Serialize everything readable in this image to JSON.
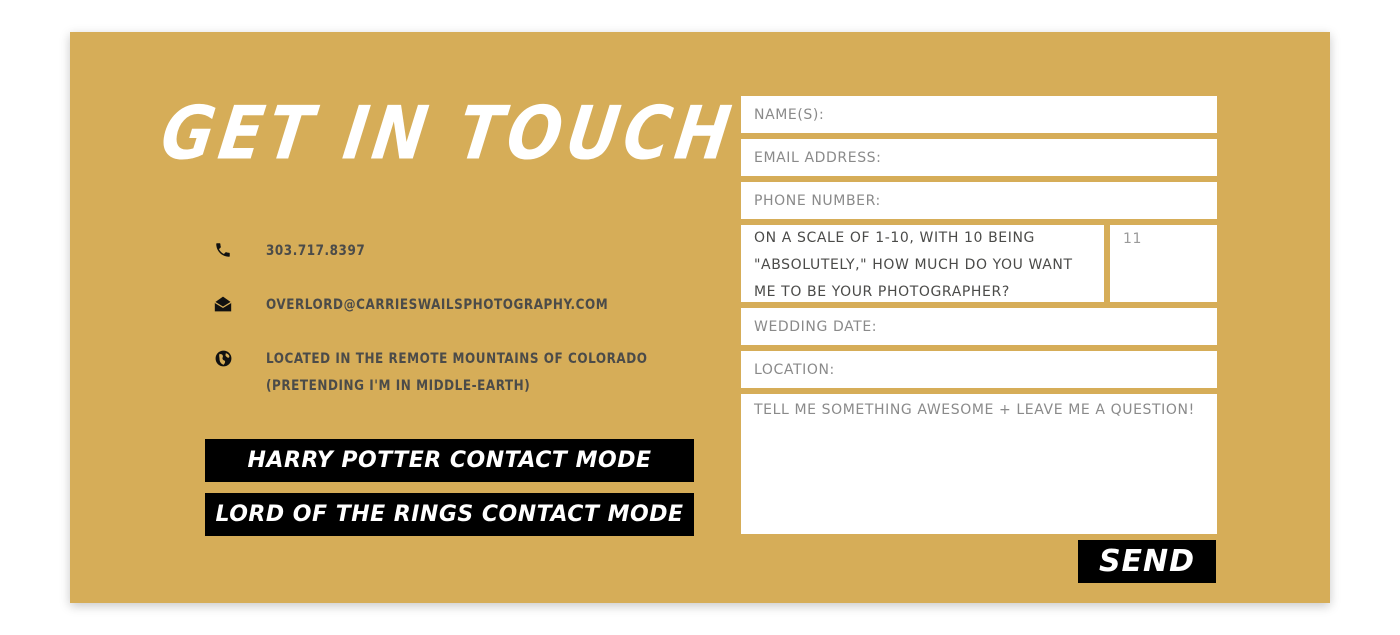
{
  "colors": {
    "panel": "#d6ad58",
    "title": "#ffffff",
    "info_text": "#4b4b49",
    "button_bg": "#000000",
    "button_text": "#ffffff",
    "field_bg": "#ffffff",
    "placeholder": "#8a8a8a"
  },
  "heading": "GET IN TOUCH",
  "contact": [
    {
      "icon": "phone-icon",
      "text": "303.717.8397"
    },
    {
      "icon": "envelope-open-icon",
      "text": "OVERLORD@CARRIESWAILSPHOTOGRAPHY.COM"
    },
    {
      "icon": "globe-icon",
      "text_line1": "LOCATED IN THE REMOTE MOUNTAINS OF COLORADO",
      "text_line2": "(PRETENDING I'M IN MIDDLE-EARTH)"
    }
  ],
  "mode_buttons": {
    "harry_potter": "HARRY POTTER CONTACT MODE",
    "lotr": "LORD OF THE RINGS CONTACT MODE"
  },
  "form": {
    "name_placeholder": "NAME(S):",
    "email_placeholder": "EMAIL ADDRESS:",
    "phone_placeholder": "PHONE NUMBER:",
    "scale_question": "ON A SCALE OF 1-10, WITH 10 BEING \"ABSOLUTELY,\" HOW MUCH DO YOU WANT ME TO BE YOUR PHOTOGRAPHER?",
    "scale_value": "11",
    "wedding_date_placeholder": "WEDDING DATE:",
    "location_placeholder": "LOCATION:",
    "message_placeholder": "TELL ME SOMETHING AWESOME + LEAVE ME A QUESTION!",
    "send_label": "SEND"
  }
}
